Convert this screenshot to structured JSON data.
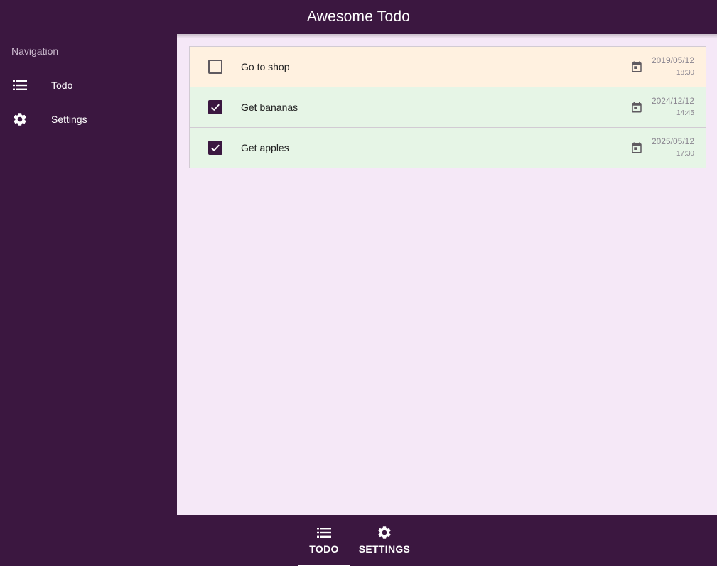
{
  "appbar": {
    "title": "Awesome Todo"
  },
  "sidenav": {
    "header": "Navigation",
    "items": [
      {
        "label": "Todo",
        "icon": "list-icon"
      },
      {
        "label": "Settings",
        "icon": "gear-icon"
      }
    ]
  },
  "todos": [
    {
      "text": "Go to shop",
      "done": false,
      "date": "2019/05/12",
      "time": "18:30"
    },
    {
      "text": "Get bananas",
      "done": true,
      "date": "2024/12/12",
      "time": "14:45"
    },
    {
      "text": "Get apples",
      "done": true,
      "date": "2025/05/12",
      "time": "17:30"
    }
  ],
  "bottomnav": {
    "tabs": [
      {
        "label": "TODO",
        "icon": "list-icon",
        "active": true
      },
      {
        "label": "SETTINGS",
        "icon": "gear-icon",
        "active": false
      }
    ]
  },
  "colors": {
    "primary": "#3b1740",
    "background": "#f5e8f7",
    "pending_row": "#fff1e0",
    "done_row": "#e6f5e6"
  }
}
